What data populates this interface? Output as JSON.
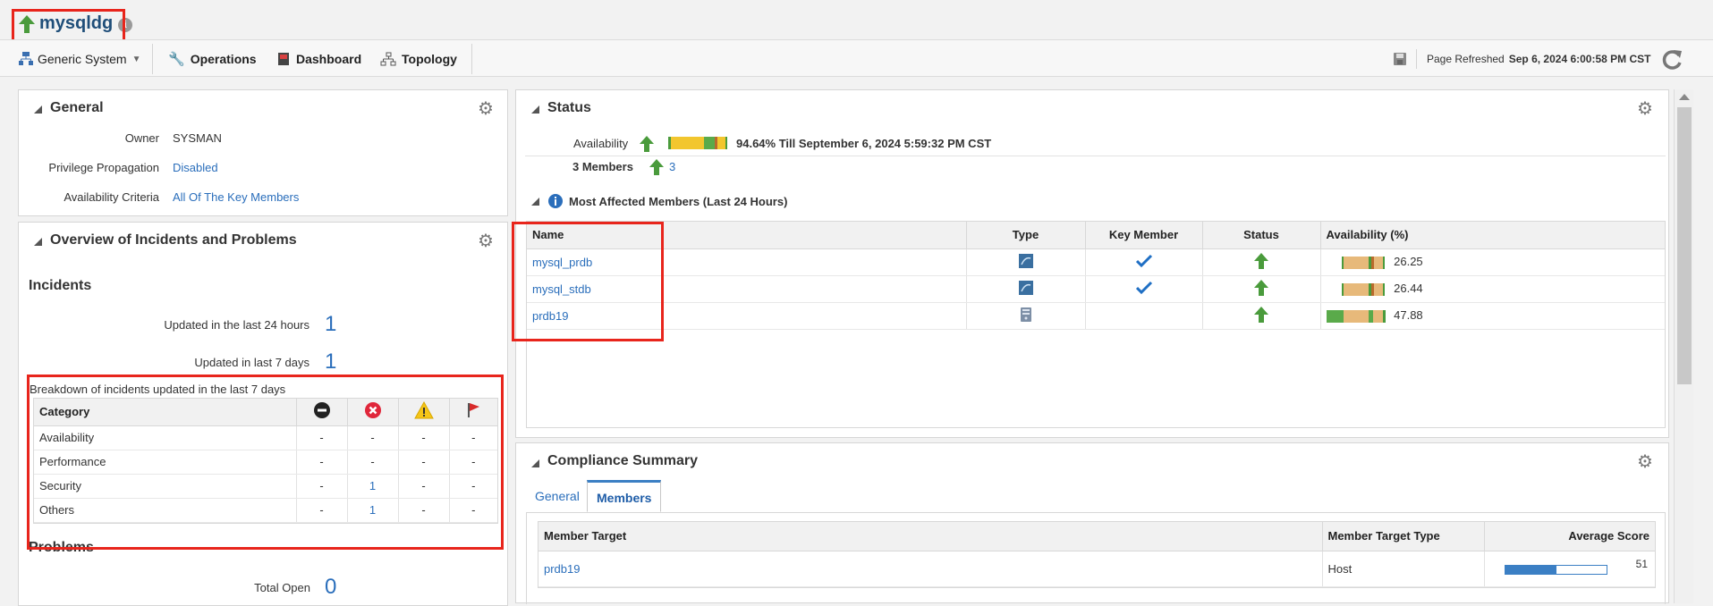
{
  "header": {
    "title": "mysqldg",
    "info_glyph": "i"
  },
  "menubar": {
    "system_label": "Generic System",
    "operations_label": "Operations",
    "dashboard_label": "Dashboard",
    "topology_label": "Topology",
    "refreshed_label": "Page Refreshed",
    "refreshed_time": "Sep 6, 2024 6:00:58 PM CST"
  },
  "general": {
    "title": "General",
    "owner_label": "Owner",
    "owner_value": "SYSMAN",
    "privilege_label": "Privilege Propagation",
    "privilege_value": "Disabled",
    "criteria_label": "Availability Criteria",
    "criteria_value": "All Of The Key Members"
  },
  "incidents": {
    "panel_title": "Overview of Incidents and Problems",
    "section_title": "Incidents",
    "updated_24h_label": "Updated in the last 24 hours",
    "updated_24h_value": "1",
    "updated_7d_label": "Updated in last 7 days",
    "updated_7d_value": "1",
    "breakdown_title": "Breakdown of incidents updated in the last 7 days",
    "category_header": "Category",
    "rows": [
      {
        "category": "Availability",
        "fatal": "-",
        "critical": "-",
        "warning": "-",
        "escalated": "-"
      },
      {
        "category": "Performance",
        "fatal": "-",
        "critical": "-",
        "warning": "-",
        "escalated": "-"
      },
      {
        "category": "Security",
        "fatal": "-",
        "critical": "1",
        "warning": "-",
        "escalated": "-"
      },
      {
        "category": "Others",
        "fatal": "-",
        "critical": "1",
        "warning": "-",
        "escalated": "-"
      }
    ],
    "problems_title": "Problems",
    "total_open_label": "Total Open",
    "total_open_value": "0"
  },
  "status": {
    "title": "Status",
    "availability_label": "Availability",
    "availability_value": "94.64% Till September 6, 2024 5:59:32 PM CST",
    "members_label": "3 Members",
    "members_up_count": "3",
    "affected_title": "Most Affected Members (Last 24 Hours)",
    "columns": [
      "Name",
      "Type",
      "Key Member",
      "Status",
      "Availability (%)"
    ],
    "members": [
      {
        "name": "mysql_prdb",
        "type_icon": "mysql-db-icon",
        "key_member": true,
        "status": "up",
        "availability": "26.25"
      },
      {
        "name": "mysql_stdb",
        "type_icon": "mysql-db-icon",
        "key_member": true,
        "status": "up",
        "availability": "26.44"
      },
      {
        "name": "prdb19",
        "type_icon": "host-icon",
        "key_member": false,
        "status": "up",
        "availability": "47.88"
      }
    ]
  },
  "compliance": {
    "title": "Compliance Summary",
    "tabs": [
      "General",
      "Members"
    ],
    "active_tab": "Members",
    "columns": [
      "Member Target",
      "Member Target Type",
      "Average Score"
    ],
    "rows": [
      {
        "target": "prdb19",
        "type": "Host",
        "score": "51",
        "score_fraction": 0.51
      }
    ]
  },
  "colors": {
    "link": "#2a6ebb",
    "up_green": "#4a9b3c",
    "highlight_red": "#e8251c",
    "score_bar": "#3b7fc4"
  }
}
